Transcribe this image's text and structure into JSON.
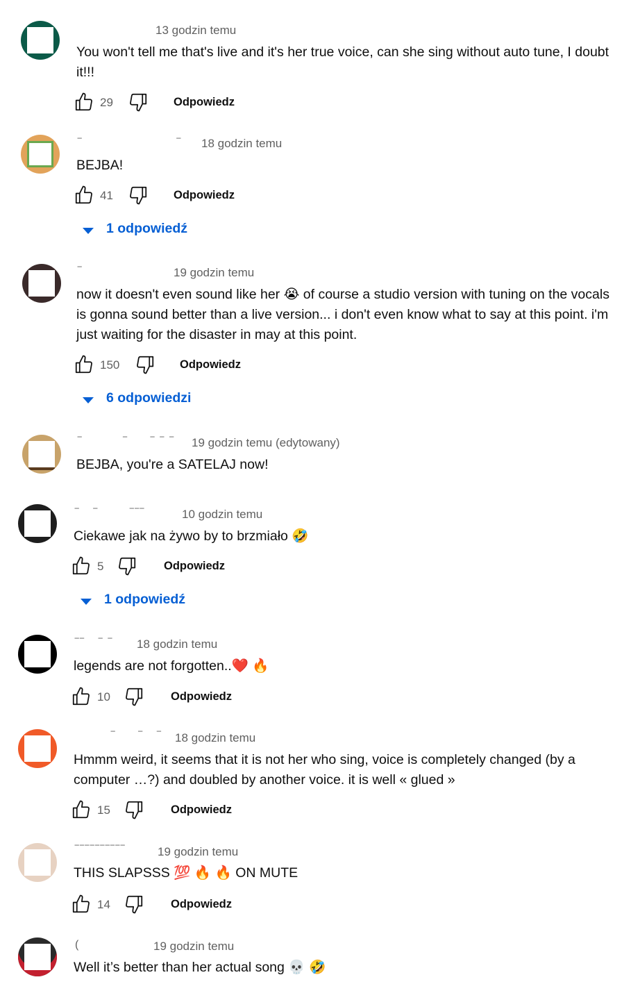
{
  "reply_label": "Odpowiedz",
  "colors": {
    "link_blue": "#065fd4",
    "meta_gray": "#606060",
    "text": "#0f0f0f"
  },
  "comments": [
    {
      "time": "13 godzin temu",
      "text": "You won't tell me that's live and it's her true voice, can she sing without auto tune, I doubt it!!!",
      "likes": "29"
    },
    {
      "time": "18 godzin temu",
      "text": "BEJBA!",
      "likes": "41",
      "replies": "1 odpowiedź"
    },
    {
      "time": "19 godzin temu",
      "text": "now it doesn't even sound like her 😭 of course a studio version with tuning on the vocals is gonna sound better than a live version... i don't even know what to say at this point. i'm just waiting for the disaster in may at this point.",
      "likes": "150",
      "replies": "6 odpowiedzi"
    },
    {
      "time": "19 godzin temu (edytowany)",
      "text": "BEJBA, you're a SATELAJ now!"
    },
    {
      "time": "10 godzin temu",
      "text": "Ciekawe jak na żywo by to brzmiało 🤣",
      "likes": "5",
      "replies": "1 odpowiedź"
    },
    {
      "time": "18 godzin temu",
      "text": "legends are not forgotten..❤️ 🔥",
      "likes": "10"
    },
    {
      "time": "18 godzin temu",
      "text": "Hmmm weird, it seems that it is not her who sing, voice is completely changed (by a computer …?) and doubled by another voice. it is well « glued »",
      "likes": "15"
    },
    {
      "time": "19 godzin temu",
      "text": "THIS SLAPSSS 💯 🔥 🔥  ON MUTE",
      "likes": "14"
    },
    {
      "time": "19 godzin temu",
      "text": "Well it’s better than her actual song 💀 🤣"
    }
  ]
}
